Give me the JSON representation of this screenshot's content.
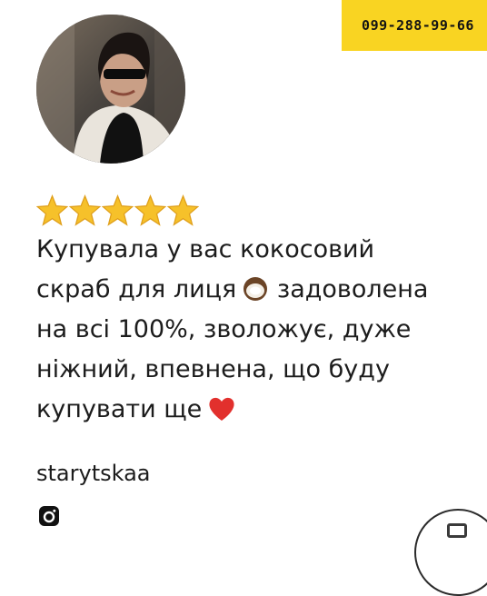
{
  "phone_banner": {
    "number": "099-288-99-66",
    "color": "#f9d422"
  },
  "avatar": {
    "description_icon": "profile-photo"
  },
  "rating": {
    "stars": 5,
    "max": 5,
    "star_color": "#f6c12a"
  },
  "review": {
    "line1": "Купувала у вас кокосовий",
    "line2": "скраб для лиця",
    "line2_end": "задоволена",
    "line3": "на всі 100%, зволожує, дуже",
    "line4": "ніжний, впевнена, що буду",
    "line5": "купувати ще",
    "emoji_coconut": "coconut-icon",
    "emoji_heart": "heart-icon"
  },
  "author": {
    "username": "starytskaa",
    "social_icon": "instagram-icon"
  },
  "chat_button": {
    "icon": "chat-icon"
  }
}
